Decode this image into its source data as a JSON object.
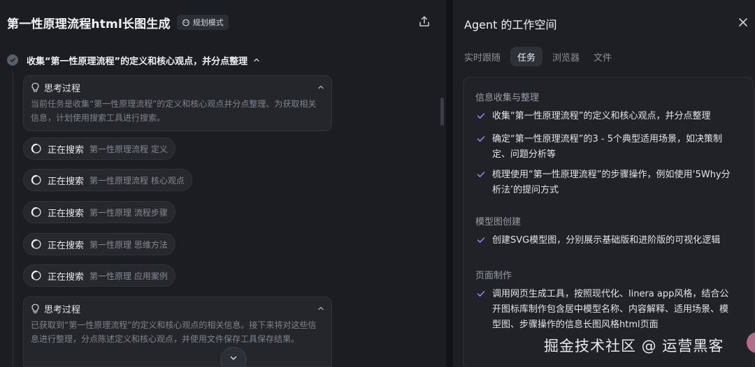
{
  "left": {
    "title": "第一性原理流程html长图生成",
    "mode_badge": "规划模式",
    "step": {
      "title": "收集“第一性原理流程”的定义和核心观点，并分点整理"
    },
    "thinking": [
      {
        "label": "思考过程",
        "text": "当前任务是收集“第一性原理流程”的定义和核心观点并分点整理、为获取相关信息，计划使用搜索工具进行搜索。"
      },
      {
        "label": "思考过程",
        "text": "已获取到“第一性原理流程”的定义和核心观点的相关信息。接下来将对这些信息进行整理，分点陈述定义和核心观点，并使用文件保存工具保存结果。"
      }
    ],
    "searches": [
      {
        "label": "正在搜索",
        "query": "第一性原理流程 定义"
      },
      {
        "label": "正在搜索",
        "query": "第一性原理流程 核心观点"
      },
      {
        "label": "正在搜索",
        "query": "第一性原理 流程步骤"
      },
      {
        "label": "正在搜索",
        "query": "第一性原理 思维方法"
      },
      {
        "label": "正在搜索",
        "query": "第一性原理 应用案例"
      }
    ]
  },
  "right": {
    "title": "Agent 的工作空间",
    "tabs": [
      "实时跟随",
      "任务",
      "浏览器",
      "文件"
    ],
    "active_tab": "任务",
    "sections": [
      {
        "title": "信息收集与整理",
        "items": [
          "收集“第一性原理流程”的定义和核心观点，并分点整理",
          "确定“第一性原理流程”的3 - 5个典型适用场景，如决策制定、问题分析等",
          "梳理使用“第一性原理流程”的步骤操作，例如使用‘5Why分析法’的提问方式"
        ]
      },
      {
        "title": "模型图创建",
        "items": [
          "创建SVG模型图，分别展示基础版和进阶版的可视化逻辑"
        ]
      },
      {
        "title": "页面制作",
        "items": [
          "调用网页生成工具，按照现代化、linera app风格，结合公开图标库制作包含居中模型名称、内容解释、适用场景、模型图、步骤操作的信息长图风格html页面"
        ]
      }
    ]
  },
  "watermark": "掘金技术社区 @ 运营黑客",
  "colors": {
    "accent_check": "#8f8cf0",
    "background": "#16181d"
  }
}
